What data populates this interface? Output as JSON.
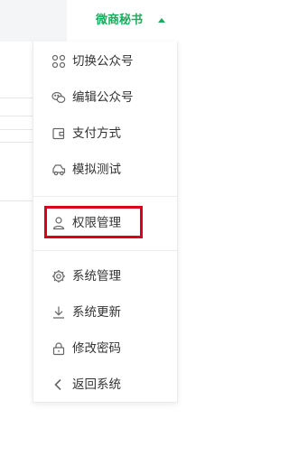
{
  "header": {
    "account_name": "微商秘书",
    "caret_icon": "caret-up-icon",
    "accent_color": "#1aad5f"
  },
  "menu": {
    "group1": [
      {
        "label": "切换公众号",
        "icon": "grid-icon"
      },
      {
        "label": "编辑公众号",
        "icon": "wechat-icon"
      },
      {
        "label": "支付方式",
        "icon": "wallet-icon"
      },
      {
        "label": "模拟测试",
        "icon": "car-icon"
      }
    ],
    "group2": [
      {
        "label": "权限管理",
        "icon": "user-icon"
      }
    ],
    "group3": [
      {
        "label": "系统管理",
        "icon": "gear-icon"
      },
      {
        "label": "系统更新",
        "icon": "download-icon"
      },
      {
        "label": "修改密码",
        "icon": "lock-icon"
      },
      {
        "label": "返回系统",
        "icon": "chevron-left-icon"
      }
    ],
    "highlight_color": "#d9001b"
  }
}
